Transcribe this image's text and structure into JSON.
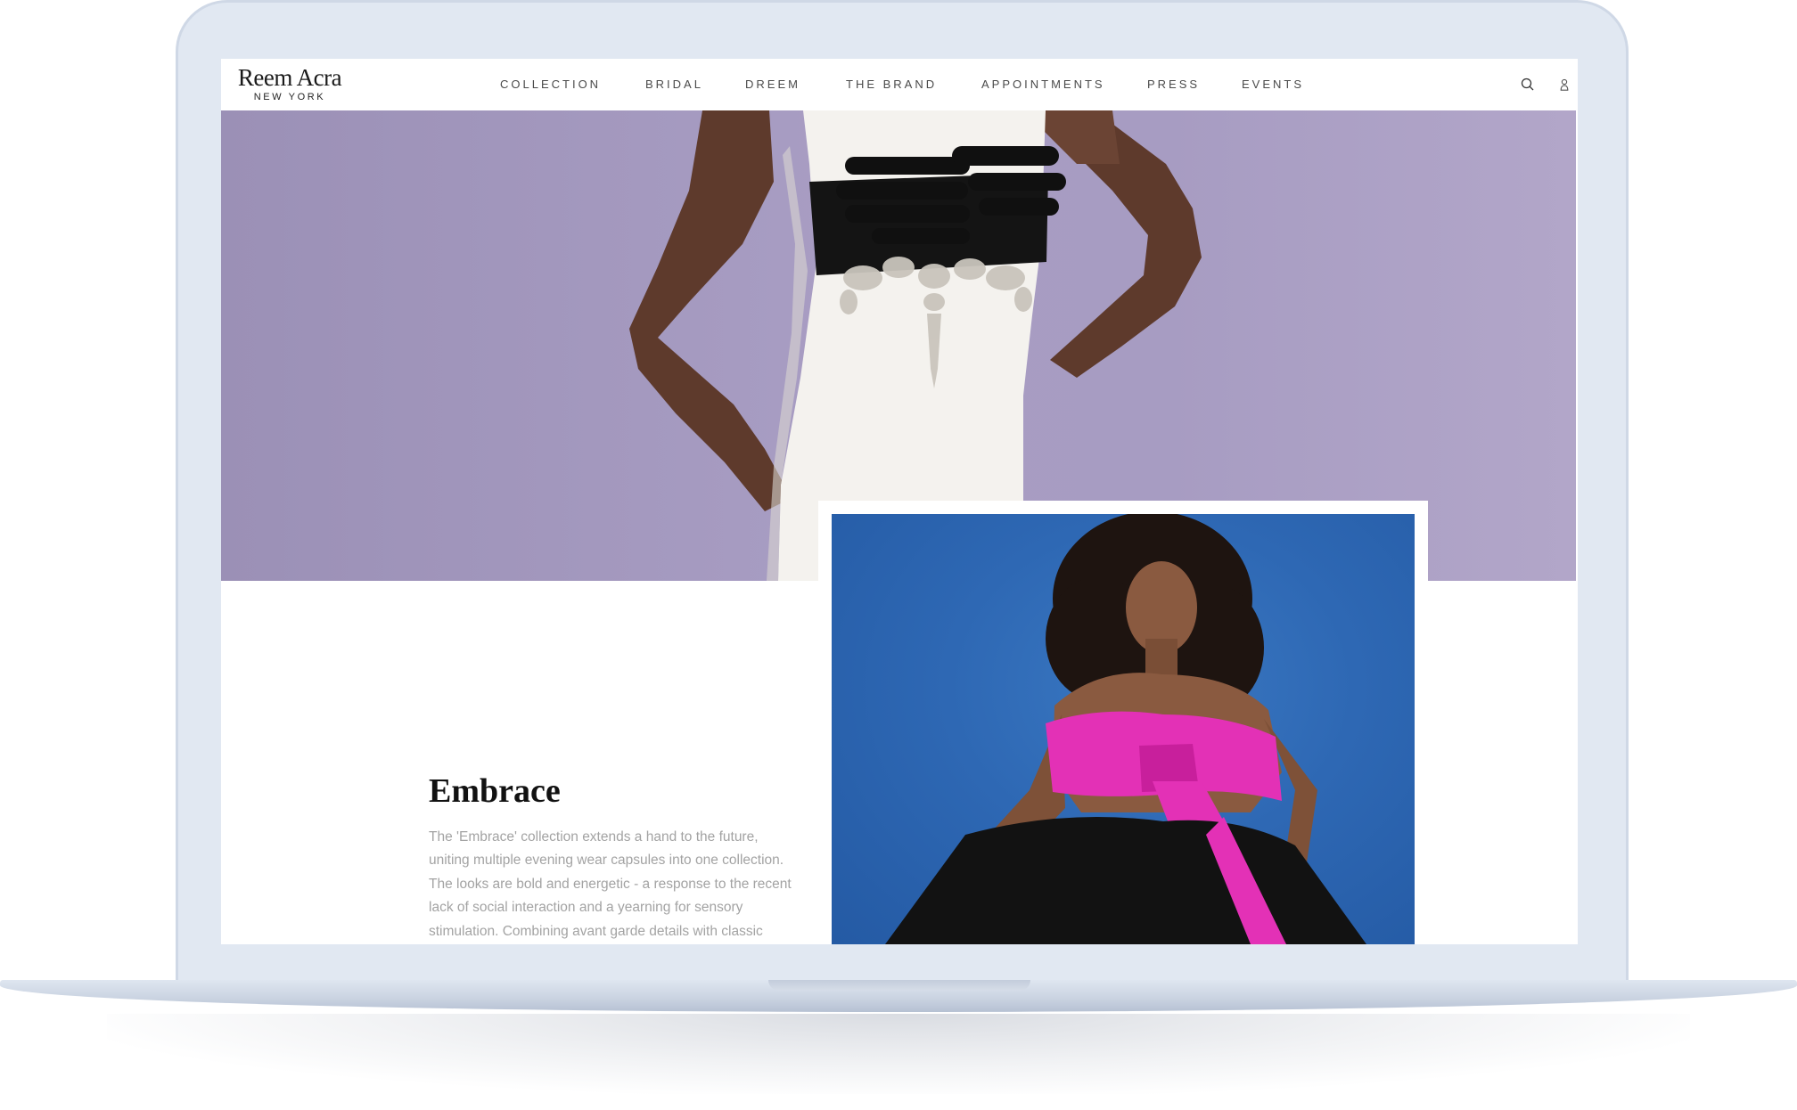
{
  "brand": {
    "name": "Reem Acra",
    "location": "NEW YORK"
  },
  "nav": {
    "items": [
      {
        "label": "COLLECTION"
      },
      {
        "label": "BRIDAL"
      },
      {
        "label": "DREEM"
      },
      {
        "label": "THE BRAND"
      },
      {
        "label": "APPOINTMENTS"
      },
      {
        "label": "PRESS"
      },
      {
        "label": "EVENTS"
      }
    ]
  },
  "icons": {
    "search": "search-icon",
    "account": "user-icon"
  },
  "hero": {
    "image": "model-white-gown-black-gloved-hands"
  },
  "feature": {
    "title": "Embrace",
    "body": "The 'Embrace' collection extends a hand to the future, uniting multiple evening wear capsules into one collection. The looks are bold and energetic - a response to the recent lack of social interaction and a yearning for sensory stimulation. Combining avant garde details with classic styles, the collection invites the modern woman to",
    "image": "model-pink-bow-top-black-skirt"
  },
  "colors": {
    "hero_background": "#a59ac0",
    "feature_background": "#2e68b4",
    "accent_pink": "#e331b6",
    "device_frame": "#e1e8f2"
  }
}
